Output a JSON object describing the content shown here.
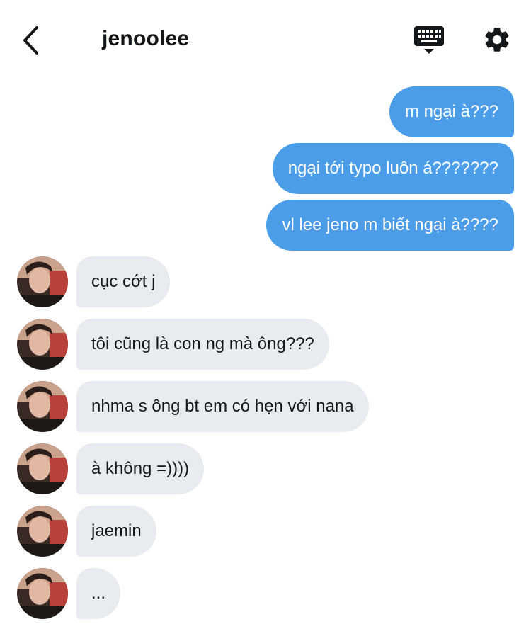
{
  "header": {
    "title": "jenoolee",
    "back_icon": "chevron-left-icon",
    "keyboard_icon": "keyboard-icon",
    "settings_icon": "gear-icon"
  },
  "colors": {
    "outgoing_bubble": "#4b9de8",
    "incoming_bubble": "#e8ebef",
    "text": "#14171a"
  },
  "messages": {
    "outgoing": [
      {
        "text": "m ngại à???"
      },
      {
        "text": "ngại tới typo luôn á???????"
      },
      {
        "text": "vl lee jeno m biết ngại à????"
      }
    ],
    "incoming": [
      {
        "text": "cục cớt j"
      },
      {
        "text": "tôi cũng là con ng mà ông???"
      },
      {
        "text": "nhma s ông bt em có hẹn với nana"
      },
      {
        "text": "à không =))))"
      },
      {
        "text": "jaemin"
      },
      {
        "text": "..."
      }
    ]
  }
}
